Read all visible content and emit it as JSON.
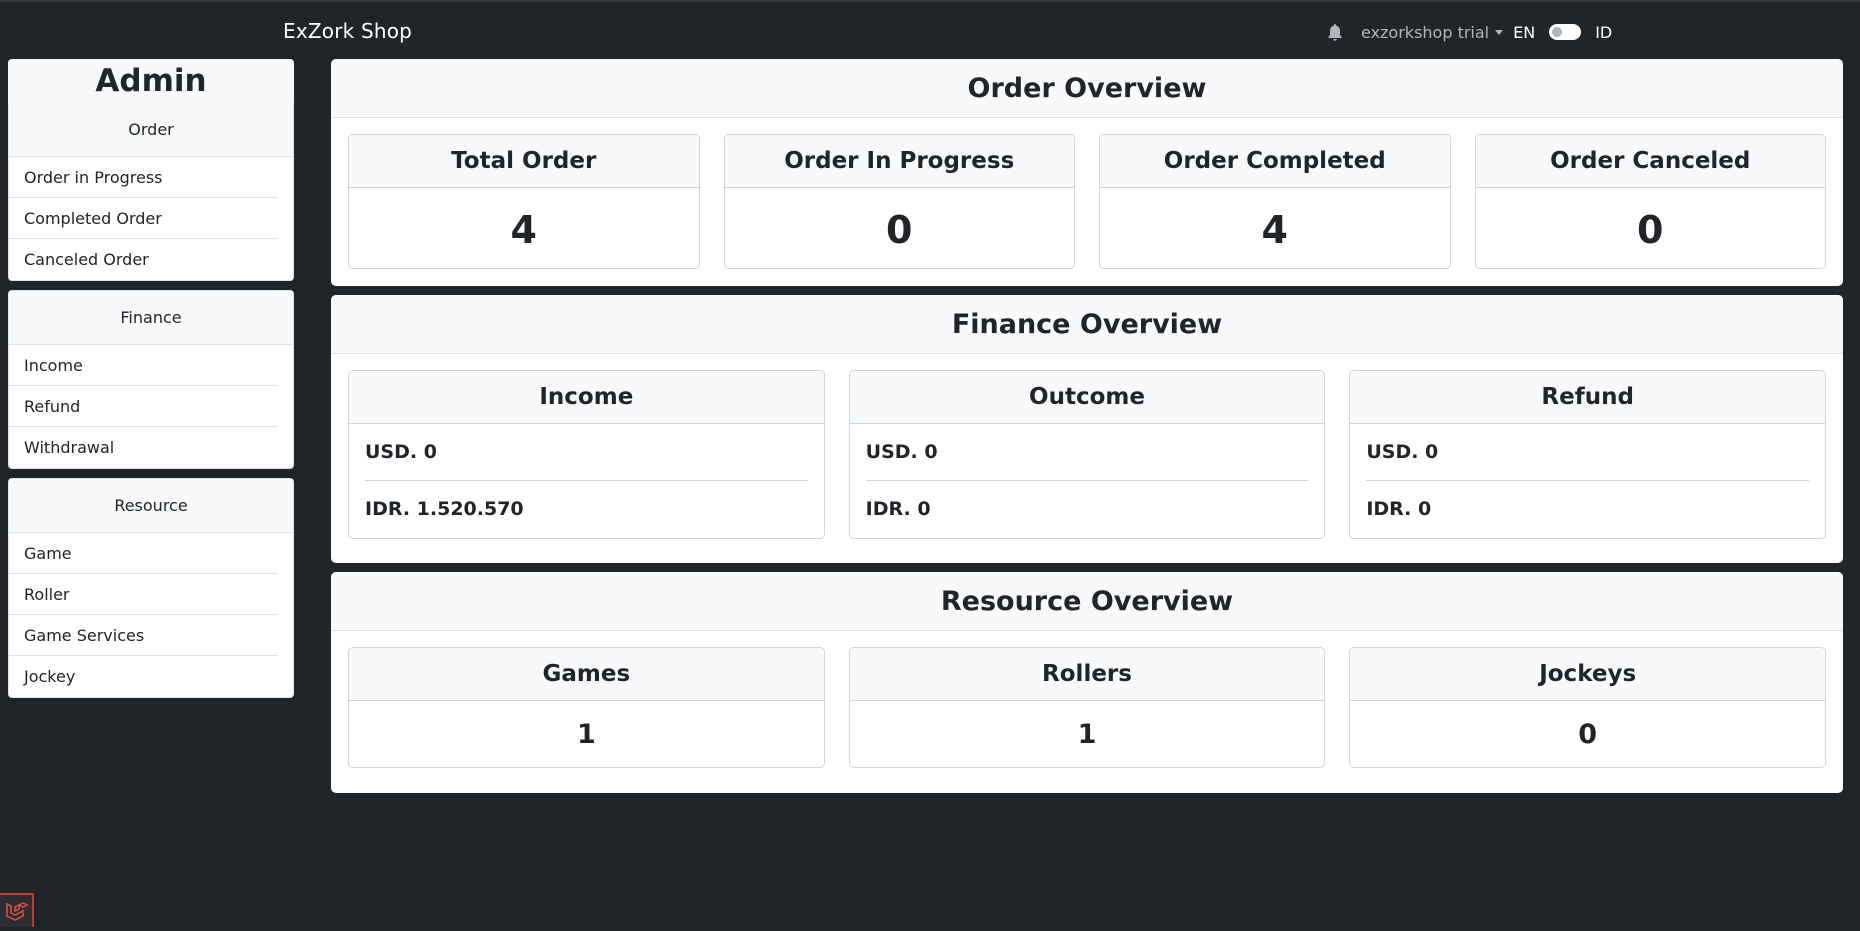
{
  "brand": "ExZork Shop",
  "topnav": {
    "user": "exzorkshop trial",
    "lang_en": "EN",
    "lang_id": "ID"
  },
  "sidebar": {
    "title": "Admin",
    "groups": [
      {
        "heading": "Order",
        "items": [
          "Order in Progress",
          "Completed Order",
          "Canceled Order"
        ]
      },
      {
        "heading": "Finance",
        "items": [
          "Income",
          "Refund",
          "Withdrawal"
        ]
      },
      {
        "heading": "Resource",
        "items": [
          "Game",
          "Roller",
          "Game Services",
          "Jockey"
        ]
      }
    ]
  },
  "order_overview": {
    "title": "Order Overview",
    "cards": [
      {
        "label": "Total Order",
        "value": "4"
      },
      {
        "label": "Order In Progress",
        "value": "0"
      },
      {
        "label": "Order Completed",
        "value": "4"
      },
      {
        "label": "Order Canceled",
        "value": "0"
      }
    ]
  },
  "finance_overview": {
    "title": "Finance Overview",
    "cards": [
      {
        "label": "Income",
        "usd": "USD. 0",
        "idr": "IDR. 1.520.570"
      },
      {
        "label": "Outcome",
        "usd": "USD. 0",
        "idr": "IDR. 0"
      },
      {
        "label": "Refund",
        "usd": "USD. 0",
        "idr": "IDR. 0"
      }
    ]
  },
  "resource_overview": {
    "title": "Resource Overview",
    "cards": [
      {
        "label": "Games",
        "value": "1"
      },
      {
        "label": "Rollers",
        "value": "1"
      },
      {
        "label": "Jockeys",
        "value": "0"
      }
    ]
  }
}
